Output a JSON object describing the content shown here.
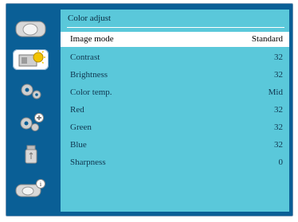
{
  "sidebar": {
    "items": [
      {
        "icon": "display-icon",
        "active": false
      },
      {
        "icon": "image-adjust-icon",
        "active": true
      },
      {
        "icon": "gear-icon",
        "active": false
      },
      {
        "icon": "gear-plus-icon",
        "active": false
      },
      {
        "icon": "usb-drive-icon",
        "active": false
      },
      {
        "icon": "info-icon",
        "active": false
      }
    ]
  },
  "panel": {
    "title": "Color adjust",
    "rows": [
      {
        "label": "Image mode",
        "value": "Standard",
        "selected": true
      },
      {
        "label": "Contrast",
        "value": "32"
      },
      {
        "label": "Brightness",
        "value": "32"
      },
      {
        "label": "Color temp.",
        "value": "Mid"
      },
      {
        "label": "Red",
        "value": "32"
      },
      {
        "label": "Green",
        "value": "32"
      },
      {
        "label": "Blue",
        "value": "32"
      },
      {
        "label": "Sharpness",
        "value": "0"
      }
    ]
  },
  "colors": {
    "frame": "#0a5f96",
    "panel": "#5ac8da",
    "selected_row": "#ffffff"
  }
}
